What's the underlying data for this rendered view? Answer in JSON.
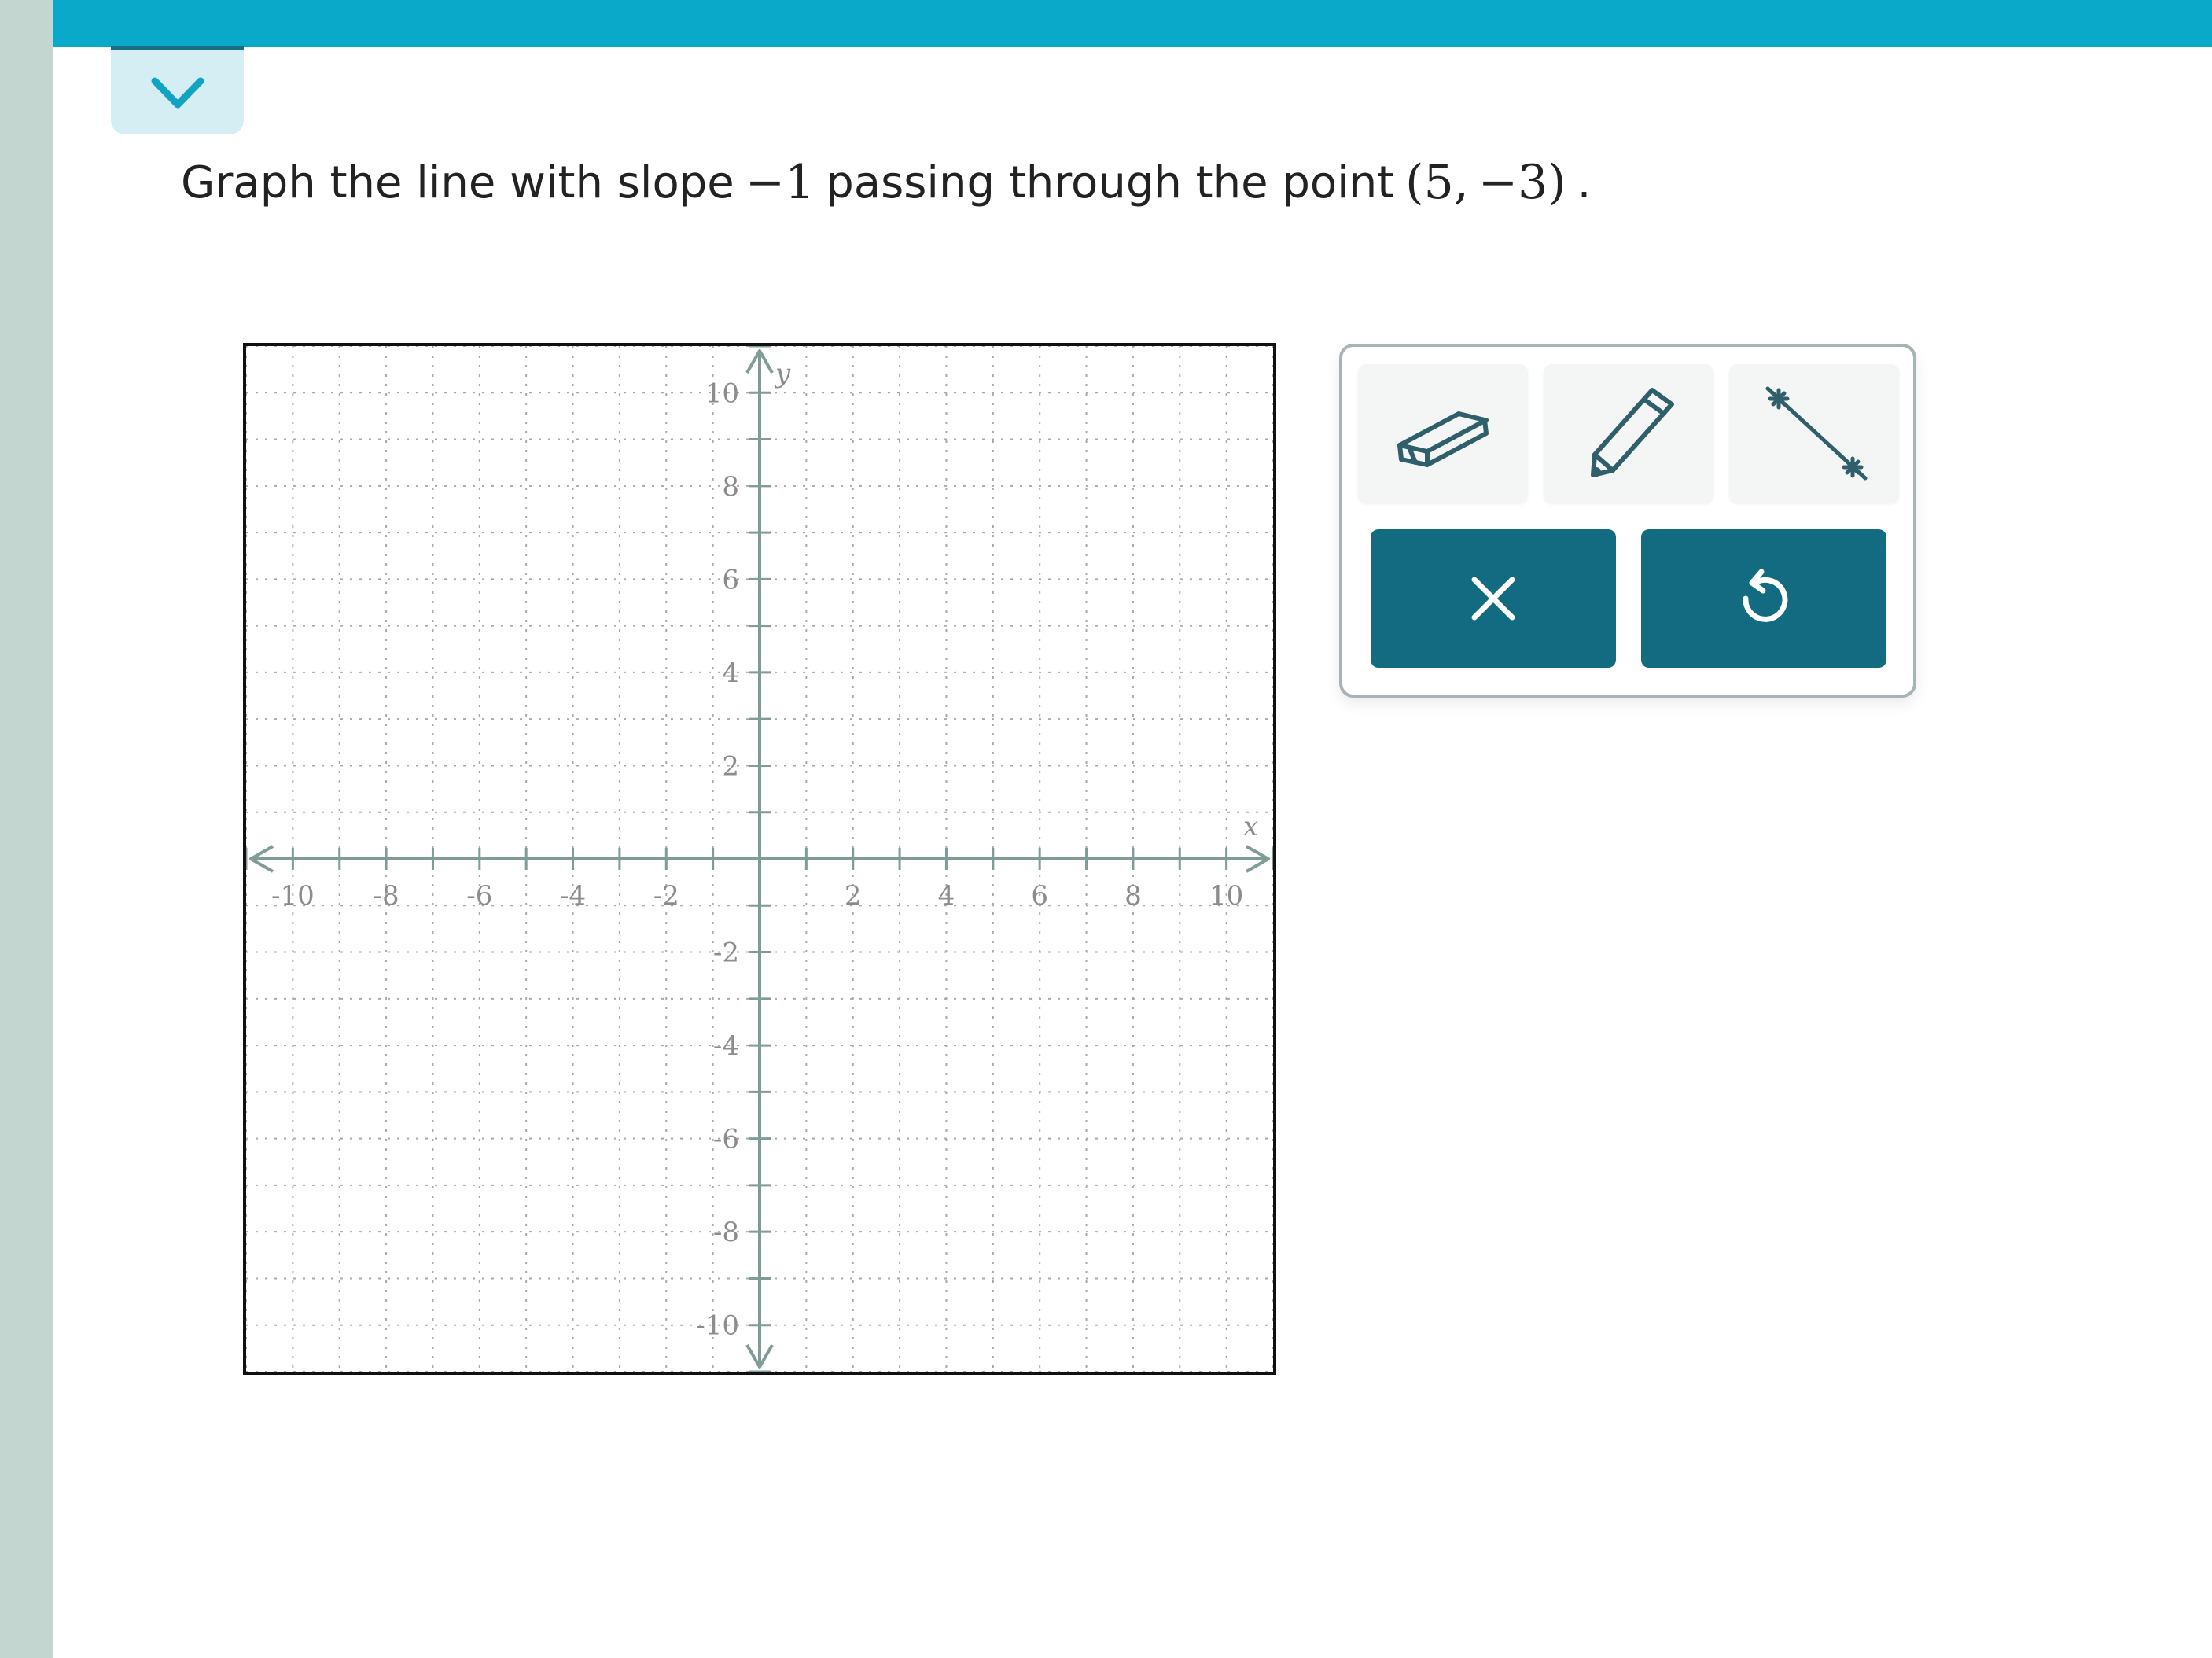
{
  "header": {
    "collapse_icon": "chevron-down-icon",
    "accent_color": "#0ba9c9"
  },
  "question": {
    "text_before": "Graph the line with slope",
    "slope": "−1",
    "text_middle": "passing through the point",
    "point": "(5, −3)",
    "text_end": "."
  },
  "graph": {
    "x_axis_label": "x",
    "y_axis_label": "y",
    "x_range": [
      -11,
      11
    ],
    "y_range": [
      -11,
      11
    ],
    "grid": true,
    "x_ticks": [
      "-10",
      "-8",
      "-6",
      "-4",
      "-2",
      "2",
      "4",
      "6",
      "8",
      "10"
    ],
    "y_ticks": [
      "10",
      "8",
      "6",
      "4",
      "2",
      "-2",
      "-4",
      "-6",
      "-8",
      "-10"
    ]
  },
  "tools": {
    "eraser_icon": "eraser-icon",
    "pencil_icon": "pencil-icon",
    "line_icon": "line-tool-icon",
    "clear_icon": "close-icon",
    "undo_icon": "undo-icon",
    "button_color": "#136b82"
  }
}
